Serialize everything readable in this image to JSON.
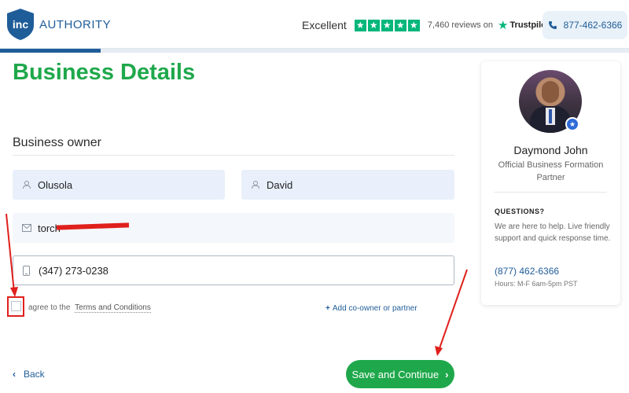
{
  "header": {
    "logo": {
      "inc": "inc",
      "brand": "AUTHORITY"
    },
    "rating": {
      "label": "Excellent",
      "star_glyph": "★",
      "reviews": "7,460 reviews on",
      "provider": "Trustpilot"
    },
    "phone": "877-462-6366",
    "progress_fraction": 0.16
  },
  "main": {
    "title": "Business Details",
    "section": "Business owner",
    "fields": {
      "first_name": "Olusola",
      "last_name": "David",
      "email_visible": "torch",
      "phone": "(347) 273-0238"
    },
    "agree": {
      "prefix": "agree to the",
      "terms": "Terms and Conditions"
    },
    "add_coowner": "Add co-owner or partner",
    "back": "Back",
    "save": "Save and Continue"
  },
  "sidebar": {
    "name": "Daymond John",
    "role": "Official Business Formation Partner",
    "questions_title": "QUESTIONS?",
    "questions_text": "We are here to help. Live friendly support and quick response time.",
    "phone": "(877) 462-6366",
    "hours": "Hours: M-F 6am-5pm PST"
  },
  "colors": {
    "accent_green": "#1fa84b",
    "brand_blue": "#1f5d99",
    "trustpilot_green": "#00b67a",
    "annotation_red": "#e0201c"
  },
  "icons": [
    "user-icon",
    "mail-icon",
    "mobile-icon",
    "phone-icon",
    "star-icon",
    "plus-icon",
    "chevron-left-icon",
    "chevron-right-icon"
  ]
}
